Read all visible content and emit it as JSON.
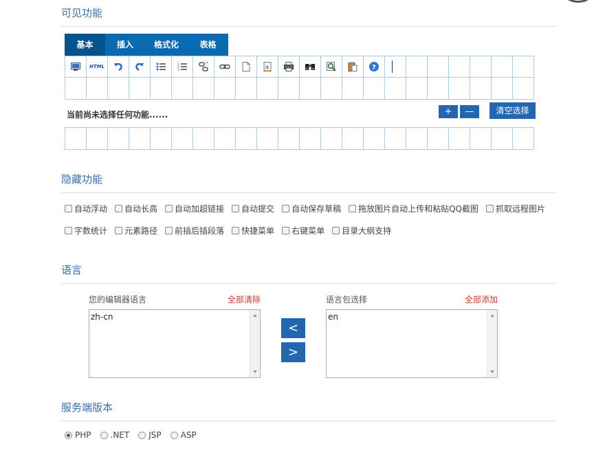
{
  "visible_section": {
    "title": "可见功能"
  },
  "tabs": [
    {
      "label": "基本",
      "active": true
    },
    {
      "label": "插入",
      "active": false
    },
    {
      "label": "格式化",
      "active": false
    },
    {
      "label": "表格",
      "active": false
    }
  ],
  "toolbar_icons": [
    "fullscreen-icon",
    "html-source-icon",
    "undo-icon",
    "redo-icon",
    "unordered-list-icon",
    "ordered-list-icon",
    "unlink-icon",
    "link-icon",
    "blank-page-icon",
    "anchor-icon",
    "print-icon",
    "find-replace-icon",
    "preview-icon",
    "paste-icon",
    "help-icon",
    "separator-icon"
  ],
  "html_icon_text": "HTML",
  "current": {
    "text": "当前尚未选择任何功能......",
    "plus": "+",
    "minus": "—",
    "clear": "清空选择"
  },
  "hidden_section": {
    "title": "隐藏功能",
    "row1": [
      "自动浮动",
      "自动长高",
      "自动加超链接",
      "自动提交",
      "自动保存草稿",
      "拖放图片自动上传和粘贴QQ截图",
      "抓取远程图片"
    ],
    "row2": [
      "字数统计",
      "元素路径",
      "前插后插段落",
      "快捷菜单",
      "右键菜单",
      "目录大纲支持"
    ]
  },
  "language_section": {
    "title": "语言",
    "editor_label": "您的编辑器语言",
    "clear_all": "全部清除",
    "editor_value": "zh-cn",
    "pack_label": "语言包选择",
    "add_all": "全部添加",
    "pack_value": "en",
    "move_left": "<",
    "move_right": ">"
  },
  "server_section": {
    "title": "服务端版本",
    "options": [
      {
        "label": "PHP",
        "selected": true
      },
      {
        "label": ".NET",
        "selected": false
      },
      {
        "label": "JSP",
        "selected": false
      },
      {
        "label": "ASP",
        "selected": false
      }
    ]
  },
  "colors": {
    "accent": "#2467b1",
    "tab_bg": "#0a6ab1",
    "tab_active": "#08528c",
    "title": "#3a6fa8",
    "link_red": "#c0392b"
  }
}
